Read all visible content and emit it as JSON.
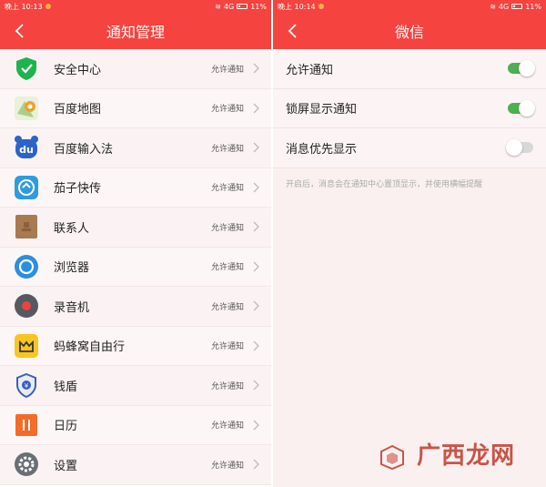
{
  "left": {
    "status": {
      "time": "晚上 10:13",
      "signal": "4G",
      "battery": "11%"
    },
    "title": "通知管理",
    "apps": [
      {
        "name": "安全中心",
        "status": "允许通知",
        "icon": "shield-check-icon",
        "color": "#1db34f"
      },
      {
        "name": "百度地图",
        "status": "允许通知",
        "icon": "map-pin-icon",
        "color": "#f0a030"
      },
      {
        "name": "百度输入法",
        "status": "允许通知",
        "icon": "du-keyboard-icon",
        "color": "#2b64c9"
      },
      {
        "name": "茄子快传",
        "status": "允许通知",
        "icon": "transfer-arrows-icon",
        "color": "#2f9be0"
      },
      {
        "name": "联系人",
        "status": "允许通知",
        "icon": "contact-book-icon",
        "color": "#a77a50"
      },
      {
        "name": "浏览器",
        "status": "允许通知",
        "icon": "browser-circle-icon",
        "color": "#2b8ee0"
      },
      {
        "name": "录音机",
        "status": "允许通知",
        "icon": "record-icon",
        "color": "#555a60"
      },
      {
        "name": "蚂蜂窝自由行",
        "status": "允许通知",
        "icon": "mafengwo-icon",
        "color": "#f8c620"
      },
      {
        "name": "钱盾",
        "status": "允许通知",
        "icon": "money-shield-icon",
        "color": "#3a5fbf"
      },
      {
        "name": "日历",
        "status": "允许通知",
        "icon": "calendar-icon",
        "color": "#f36b2a"
      },
      {
        "name": "设置",
        "status": "允许通知",
        "icon": "gear-icon",
        "color": "#6a6f75"
      }
    ]
  },
  "right": {
    "status": {
      "time": "晚上 10:14",
      "signal": "4G",
      "battery": "11%"
    },
    "title": "微信",
    "settings": [
      {
        "label": "允许通知",
        "on": true
      },
      {
        "label": "锁屏显示通知",
        "on": true
      },
      {
        "label": "消息优先显示",
        "on": false
      }
    ],
    "hint": "开启后，消息会在通知中心置顶显示，并使用横幅提醒"
  },
  "watermark": "广西龙网",
  "colors": {
    "accent": "#f5433f",
    "toggle_on": "#4cb050",
    "toggle_off": "#d8d8d8"
  }
}
